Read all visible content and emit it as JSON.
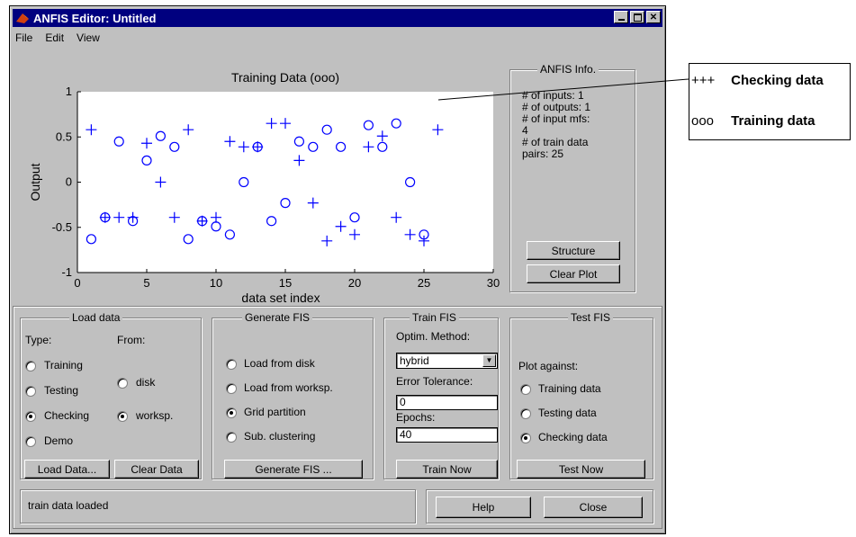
{
  "window": {
    "title": "ANFIS Editor: Untitled",
    "controls": [
      "_",
      "□",
      "X"
    ]
  },
  "menu": [
    "File",
    "Edit",
    "View"
  ],
  "plot": {
    "title": "Training Data (ooo)",
    "xlabel": "data set index",
    "ylabel": "Output",
    "x_ticks": [
      "0",
      "5",
      "10",
      "15",
      "20",
      "25",
      "30"
    ],
    "y_ticks": [
      "1",
      "0.5",
      "0",
      "-0.5",
      "-1"
    ]
  },
  "chart_data": {
    "type": "scatter",
    "title": "Training Data (ooo)",
    "xlabel": "data set index",
    "ylabel": "Output",
    "xlim": [
      0,
      30
    ],
    "ylim": [
      -1,
      1
    ],
    "grid": false,
    "series": [
      {
        "name": "Training data",
        "marker": "o",
        "x": [
          1,
          2,
          3,
          4,
          5,
          6,
          7,
          8,
          9,
          10,
          11,
          12,
          13,
          14,
          15,
          16,
          17,
          18,
          19,
          20,
          21,
          22,
          23,
          24,
          25
        ],
        "y": [
          -0.63,
          -0.39,
          0.45,
          -0.43,
          0.24,
          0.51,
          0.39,
          -0.63,
          -0.43,
          -0.49,
          -0.58,
          0.0,
          0.39,
          -0.43,
          -0.23,
          0.45,
          0.39,
          0.58,
          0.39,
          -0.39,
          0.63,
          0.39,
          0.65,
          0.0,
          -0.58
        ]
      },
      {
        "name": "Checking data",
        "marker": "+",
        "x": [
          1,
          2,
          3,
          4,
          5,
          6,
          7,
          8,
          9,
          10,
          11,
          12,
          13,
          14,
          15,
          16,
          17,
          18,
          19,
          20,
          21,
          22,
          23,
          24,
          25,
          26
        ],
        "y": [
          0.58,
          -0.39,
          -0.39,
          -0.39,
          0.43,
          0.0,
          -0.39,
          0.58,
          -0.43,
          -0.39,
          0.45,
          0.39,
          0.39,
          0.65,
          0.65,
          0.24,
          -0.23,
          -0.65,
          -0.49,
          -0.58,
          0.39,
          0.51,
          -0.39,
          -0.58,
          -0.65,
          0.58
        ]
      }
    ]
  },
  "info": {
    "title": "ANFIS Info.",
    "lines": [
      "# of inputs: 1",
      "# of outputs: 1",
      "# of input mfs:",
      "4",
      "# of train data",
      "pairs: 25"
    ],
    "structure_label": "Structure",
    "clear_plot_label": "Clear Plot"
  },
  "load": {
    "title": "Load data",
    "type_label": "Type:",
    "from_label": "From:",
    "types": [
      "Training",
      "Testing",
      "Checking",
      "Demo"
    ],
    "type_selected": "Checking",
    "sources": [
      "disk",
      "worksp."
    ],
    "source_selected": "worksp.",
    "load_button": "Load Data...",
    "clear_button": "Clear Data"
  },
  "generate": {
    "title": "Generate FIS",
    "options": [
      "Load from disk",
      "Load from worksp.",
      "Grid partition",
      "Sub. clustering"
    ],
    "selected": "Grid partition",
    "button": "Generate FIS ..."
  },
  "train": {
    "title": "Train FIS",
    "method_label": "Optim. Method:",
    "method_value": "hybrid",
    "tolerance_label": "Error Tolerance:",
    "tolerance_value": "0",
    "epochs_label": "Epochs:",
    "epochs_value": "40",
    "button": "Train Now"
  },
  "test": {
    "title": "Test FIS",
    "plot_against_label": "Plot against:",
    "options": [
      "Training data",
      "Testing data",
      "Checking data"
    ],
    "selected": "Checking data",
    "button": "Test Now"
  },
  "status": {
    "text": "train data loaded",
    "help_label": "Help",
    "close_label": "Close"
  },
  "callout": {
    "row1_symbol": "+++",
    "row1_text": "Checking data",
    "row2_symbol": "ooo",
    "row2_text": "Training data"
  }
}
